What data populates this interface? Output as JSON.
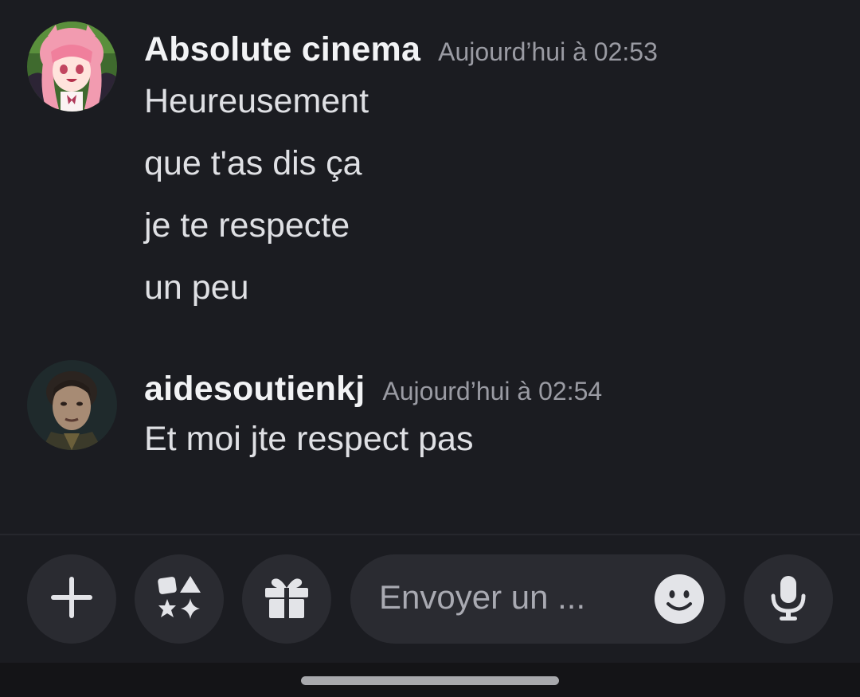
{
  "messages": [
    {
      "author": "Absolute cinema",
      "timestamp": "Aujourd’hui à 02:53",
      "avatar_icon": "anime-girl-avatar",
      "lines": [
        "Heureusement",
        "que t'as dis ça",
        "je te respecte",
        "un peu"
      ]
    },
    {
      "author": "aidesoutienkj",
      "timestamp": "Aujourd’hui à 02:54",
      "avatar_icon": "joker-portrait-avatar",
      "lines": [
        "Et moi jte respect pas"
      ]
    }
  ],
  "composer": {
    "placeholder": "Envoyer un ...",
    "buttons": [
      "plus-icon",
      "apps-icon",
      "gift-icon",
      "emoji-icon",
      "microphone-icon"
    ]
  },
  "colors": {
    "background": "#1b1c21",
    "button_bg": "#2a2b31",
    "author": "#f2f3f5",
    "timestamp": "#9a9ba3",
    "text": "#dfe0e4"
  }
}
